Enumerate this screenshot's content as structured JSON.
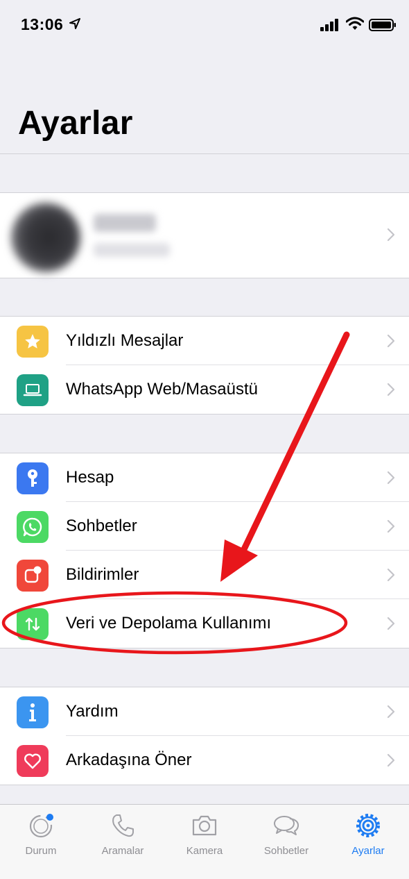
{
  "status": {
    "time": "13:06"
  },
  "header": {
    "title": "Ayarlar"
  },
  "group1": [
    {
      "label": "Yıldızlı Mesajlar",
      "icon": "star-icon",
      "color": "#f6c443"
    },
    {
      "label": "WhatsApp Web/Masaüstü",
      "icon": "laptop-icon",
      "color": "#1fa185"
    }
  ],
  "group2": [
    {
      "label": "Hesap",
      "icon": "key-icon",
      "color": "#3b78f0"
    },
    {
      "label": "Sohbetler",
      "icon": "whatsapp-icon",
      "color": "#4cd964"
    },
    {
      "label": "Bildirimler",
      "icon": "notification-icon",
      "color": "#f0473a"
    },
    {
      "label": "Veri ve Depolama Kullanımı",
      "icon": "data-arrows-icon",
      "color": "#4cd964"
    }
  ],
  "group3": [
    {
      "label": "Yardım",
      "icon": "info-icon",
      "color": "#3b95f0"
    },
    {
      "label": "Arkadaşına Öner",
      "icon": "heart-icon",
      "color": "#ef3b5a"
    }
  ],
  "tabbar": [
    {
      "label": "Durum",
      "icon": "status-icon"
    },
    {
      "label": "Aramalar",
      "icon": "phone-icon"
    },
    {
      "label": "Kamera",
      "icon": "camera-icon"
    },
    {
      "label": "Sohbetler",
      "icon": "chats-icon"
    },
    {
      "label": "Ayarlar",
      "icon": "settings-gear-icon",
      "active": true
    }
  ],
  "colors": {
    "accent": "#1e7cf2",
    "annotation": "#e8161b",
    "background": "#efeff4"
  }
}
